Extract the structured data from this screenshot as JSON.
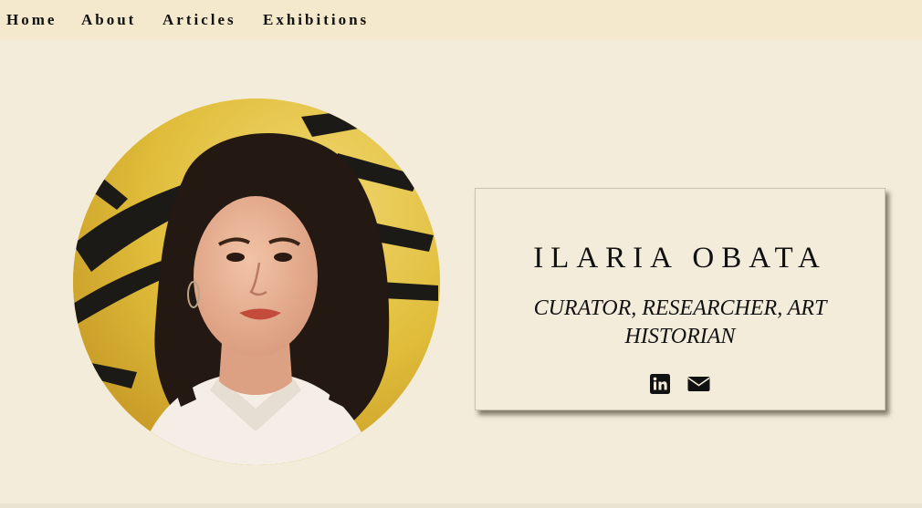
{
  "nav": {
    "items": [
      {
        "label": "Home"
      },
      {
        "label": "About"
      },
      {
        "label": "Articles"
      },
      {
        "label": "Exhibitions"
      }
    ]
  },
  "profile": {
    "name": "ILARIA OBATA",
    "subtitle": "CURATOR, RESEARCHER, ART HISTORIAN",
    "icons": [
      "linkedin-icon",
      "envelope-icon"
    ]
  },
  "colors": {
    "background": "#f3ecdb",
    "nav_background": "#f4e9cc",
    "text": "#111111",
    "portrait_background": "#e2c23d"
  }
}
